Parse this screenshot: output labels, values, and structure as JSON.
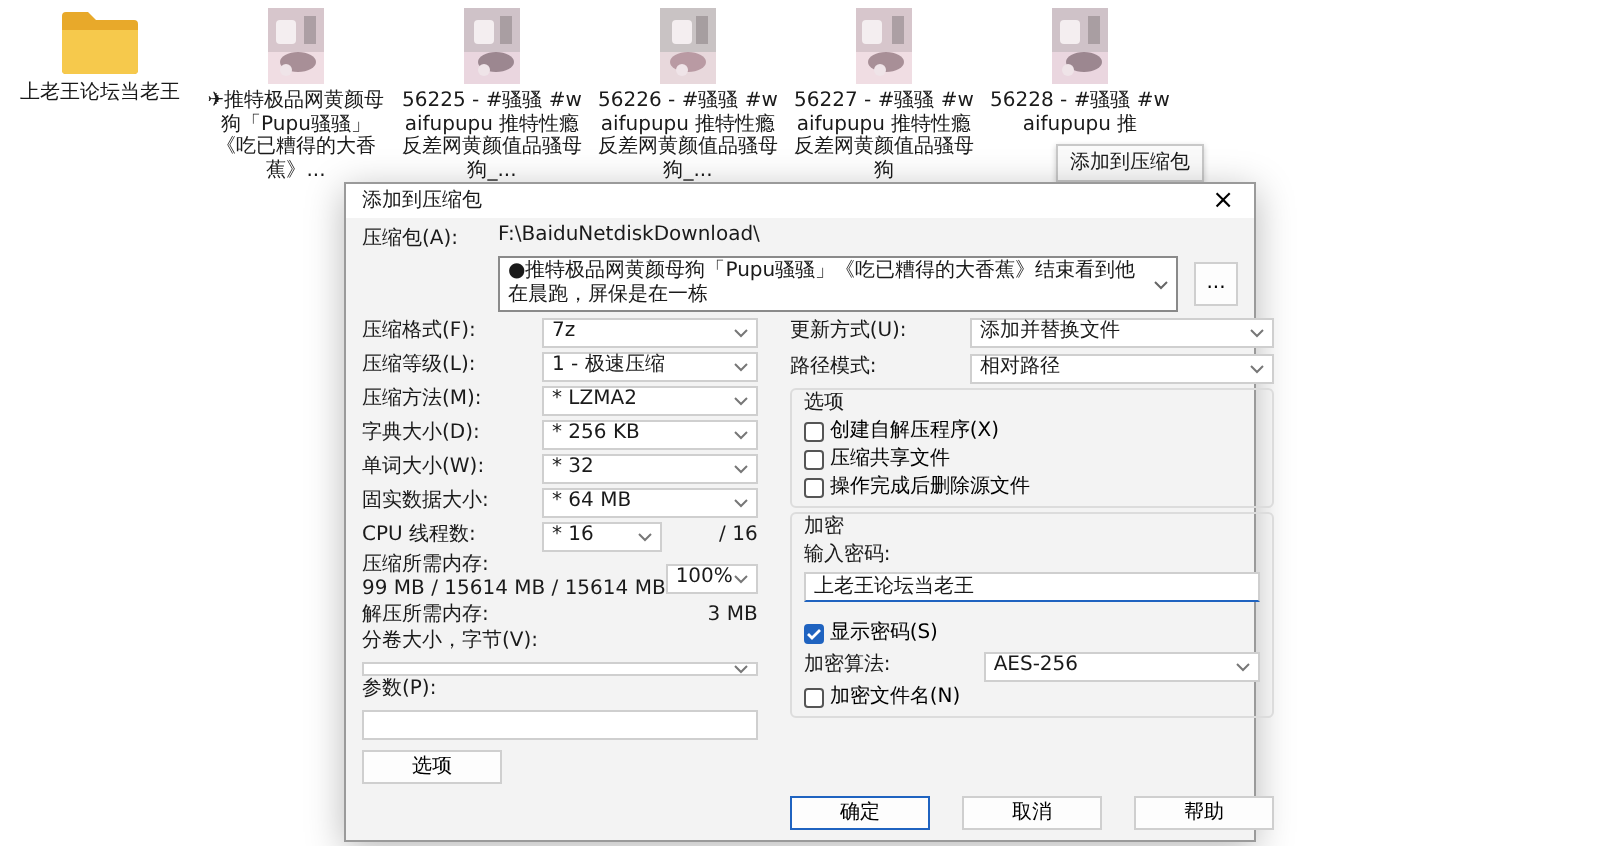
{
  "files": [
    {
      "kind": "folder",
      "label": "上老王论坛当老王"
    },
    {
      "kind": "picture",
      "label": "✈推特极品网黄颜母狗「Pupu骚骚」《吃已糟得的大香蕉》..."
    },
    {
      "kind": "picture",
      "label": "56225 - #骚骚 #waifupupu 推特性瘾反差网黄颜值品骚母狗_..."
    },
    {
      "kind": "picture",
      "label": "56226 - #骚骚 #waifupupu 推特性瘾反差网黄颜值品骚母狗_..."
    },
    {
      "kind": "picture",
      "label": "56227 - #骚骚 #waifupupu 推特性瘾反差网黄颜值品骚母狗"
    },
    {
      "kind": "picture",
      "label": "56228 - #骚骚 #waifupupu 推"
    }
  ],
  "tooltip": "添加到压缩包",
  "dialog": {
    "title": "添加到压缩包",
    "close": "×",
    "archive": {
      "label": "压缩包(A):",
      "folder": "F:\\BaiduNetdiskDownload\\",
      "value": "●推特极品网黄颜母狗「Pupu骚骚」《吃已糟得的大香蕉》结束看到他在晨跑，屏保是在一栋",
      "browse": "..."
    },
    "left": [
      {
        "kind": "select",
        "label": "压缩格式(F):",
        "value": "7z"
      },
      {
        "kind": "select",
        "label": "压缩等级(L):",
        "value": "1 - 极速压缩"
      },
      {
        "kind": "select",
        "label": "压缩方法(M):",
        "value": "* LZMA2"
      },
      {
        "kind": "select",
        "label": "字典大小(D):",
        "value": "* 256 KB"
      },
      {
        "kind": "select",
        "label": "单词大小(W):",
        "value": "* 32"
      },
      {
        "kind": "select",
        "label": "固实数据大小:",
        "value": "* 64 MB"
      },
      {
        "kind": "threads",
        "label": "CPU 线程数:",
        "value": "* 16",
        "max": "/ 16"
      },
      {
        "kind": "memory",
        "label": "压缩所需内存:",
        "detail": "99 MB / 15614 MB / 15614 MB",
        "value": "100%"
      },
      {
        "kind": "info",
        "label": "解压所需内存:",
        "value": "3 MB"
      },
      {
        "kind": "select-wide",
        "label": "分卷大小，字节(V):"
      },
      {
        "kind": "input-wide",
        "label": "参数(P):"
      }
    ],
    "options_button": "选项",
    "right": [
      {
        "label": "更新方式(U):",
        "value": "添加并替换文件"
      },
      {
        "label": "路径模式:",
        "value": "相对路径"
      }
    ],
    "options_group": {
      "title": "选项",
      "items": [
        {
          "label": "创建自解压程序(X)",
          "checked": false
        },
        {
          "label": "压缩共享文件",
          "checked": false
        },
        {
          "label": "操作完成后删除源文件",
          "checked": false
        }
      ]
    },
    "encryption": {
      "title": "加密",
      "password_label": "输入密码:",
      "password": "上老王论坛当老王",
      "show_password": {
        "label": "显示密码(S)",
        "checked": true
      },
      "method_label": "加密算法:",
      "method": "AES-256",
      "encrypt_names": {
        "label": "加密文件名(N)",
        "checked": false
      }
    },
    "buttons": [
      {
        "label": "确定",
        "default": true
      },
      {
        "label": "取消",
        "default": false
      },
      {
        "label": "帮助",
        "default": false
      }
    ]
  }
}
